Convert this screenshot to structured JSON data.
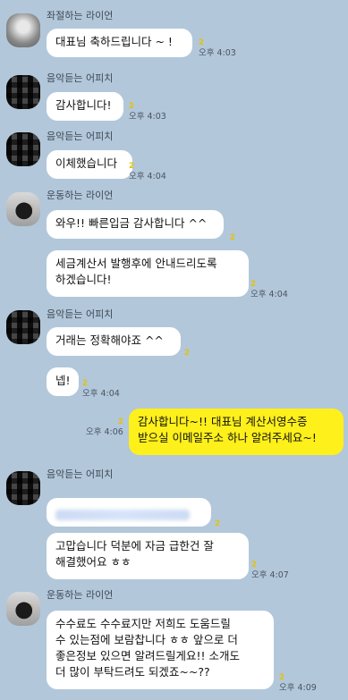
{
  "msgs": [
    {
      "name": "좌절하는 라이언",
      "text": "대표님 축하드립니다 ~ !",
      "time": "오후 4:03",
      "unread": "2"
    },
    {
      "name": "음악듣는 어피치",
      "text": "감사합니다!",
      "time": "오후 4:03",
      "unread": "2"
    },
    {
      "name": "음악듣는 어피치",
      "text": "이체했습니다",
      "time": "오후 4:04",
      "unread": "2"
    },
    {
      "name": "운동하는 라이언",
      "text": "와우!! 빠른입금 감사합니다 ^^",
      "unread": "2"
    },
    {
      "text": "세금계산서 발행후에 안내드리도록\n하겠습니다!",
      "time": "오후 4:04",
      "unread": "2"
    },
    {
      "name": "음악듣는 어피치",
      "text": "거래는 정확해야죠 ^^",
      "unread": "2"
    },
    {
      "text": "넵!",
      "time": "오후 4:04",
      "unread": "2"
    },
    {
      "text": "감사합니다~!! 대표님 계산서영수증\n받으실 이메일주소 하나 알려주세요~!",
      "time": "오후 4:06",
      "unread": "2"
    },
    {
      "name": "음악듣는 어피치",
      "unread": "2"
    },
    {
      "text": "고맙습니다 덕분에 자금 급한건 잘\n해결했어요 ㅎㅎ",
      "time": "오후 4:07",
      "unread": "2"
    },
    {
      "name": "운동하는 라이언",
      "text": "수수료도 수수료지만 저희도 도움드릴\n수 있는점에 보람찹니다 ㅎㅎ 앞으로 더\n좋은정보 있으면 알려드릴게요!! 소개도\n더 많이 부탁드려도 되겠죠~~??",
      "time": "오후 4:09",
      "unread": "2"
    }
  ]
}
